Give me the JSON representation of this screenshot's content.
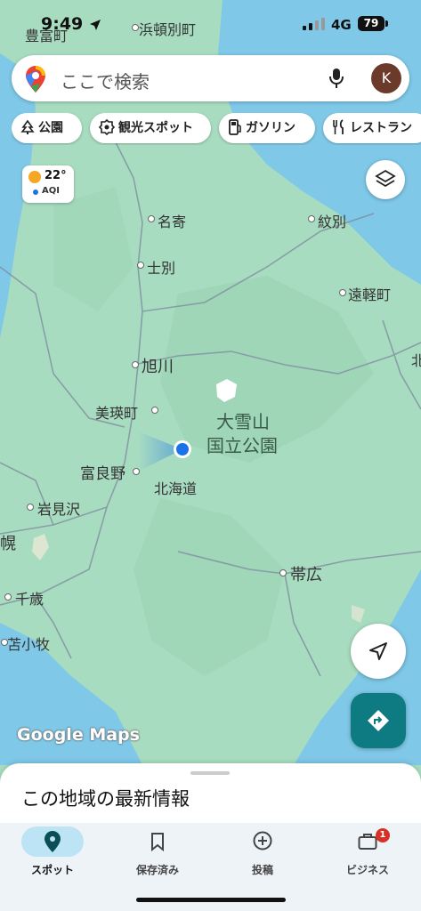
{
  "status": {
    "time": "9:49",
    "network": "4G",
    "battery": "79",
    "top_place": "浜頓別町",
    "top_place_left": "豊富町"
  },
  "search": {
    "placeholder": "ここで検索",
    "avatar_initial": "K"
  },
  "chips": [
    {
      "label": "公園",
      "icon": "tree-icon"
    },
    {
      "label": "観光スポット",
      "icon": "camera-icon"
    },
    {
      "label": "ガソリン",
      "icon": "gas-pump-icon"
    },
    {
      "label": "レストラン",
      "icon": "fork-knife-icon"
    }
  ],
  "weather": {
    "temp": "22°",
    "aqi": "AQI"
  },
  "map": {
    "labels": {
      "nayoro": "名寄",
      "monbetsu": "紋別",
      "shibetsu": "士別",
      "engaru": "遠軽町",
      "asahikawa": "旭川",
      "kita": "北",
      "biei": "美瑛町",
      "daisetsuzan_1": "大雪山",
      "daisetsuzan_2": "国立公園",
      "furano": "富良野",
      "hokkaido": "北海道",
      "iwamizawa": "岩見沢",
      "ho": "幌",
      "obihiro": "帯広",
      "chitose": "千歳",
      "tomakomai": "苫小牧"
    },
    "watermark": "Google Maps",
    "colors": {
      "land": "#a8dcc0",
      "water": "#7fc8e8",
      "location": "#1a73e8"
    }
  },
  "sheet": {
    "title": "この地域の最新情報"
  },
  "bottom_nav": [
    {
      "label": "スポット",
      "icon": "location-pin-icon",
      "active": true
    },
    {
      "label": "保存済み",
      "icon": "bookmark-icon",
      "active": false
    },
    {
      "label": "投稿",
      "icon": "plus-circle-icon",
      "active": false
    },
    {
      "label": "ビジネス",
      "icon": "briefcase-icon",
      "active": false,
      "badge": "1"
    }
  ]
}
